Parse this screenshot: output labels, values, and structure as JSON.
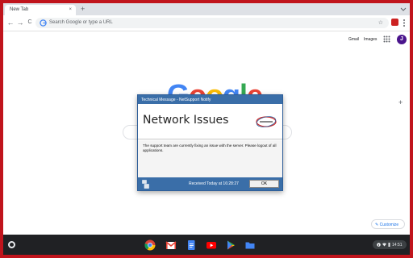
{
  "browser": {
    "tab_title": "New Tab",
    "tab_close": "×",
    "new_tab": "+",
    "omnibox_placeholder": "Search Google or type a URL",
    "back": "←",
    "forward": "→",
    "reload": "C",
    "star": "☆"
  },
  "ntp": {
    "gmail": "Gmail",
    "images": "Images",
    "avatar_letter": "J",
    "logo_letters": [
      "G",
      "o",
      "o",
      "g",
      "l",
      "e"
    ],
    "logo_colors": [
      "#4285f4",
      "#ea4335",
      "#fbbc05",
      "#4285f4",
      "#34a853",
      "#ea4335"
    ],
    "side_plus": "+",
    "customize": "✎ Customize"
  },
  "dialog": {
    "title": "Technical Message - NetSupport Notify",
    "heading": "Network Issues",
    "body": "The support team are currently fixing an issue with the server. Please logout of all applications.",
    "received": "Received Today at 16:28:27",
    "ok": "OK"
  },
  "shelf": {
    "apps": [
      "chrome-icon",
      "gmail-icon",
      "docs-icon",
      "youtube-icon",
      "play-store-icon",
      "files-icon"
    ],
    "time": "14:51"
  },
  "colors": {
    "frame": "#c0141c",
    "dialog_blue": "#3a6ea8",
    "shelf": "#202124"
  }
}
